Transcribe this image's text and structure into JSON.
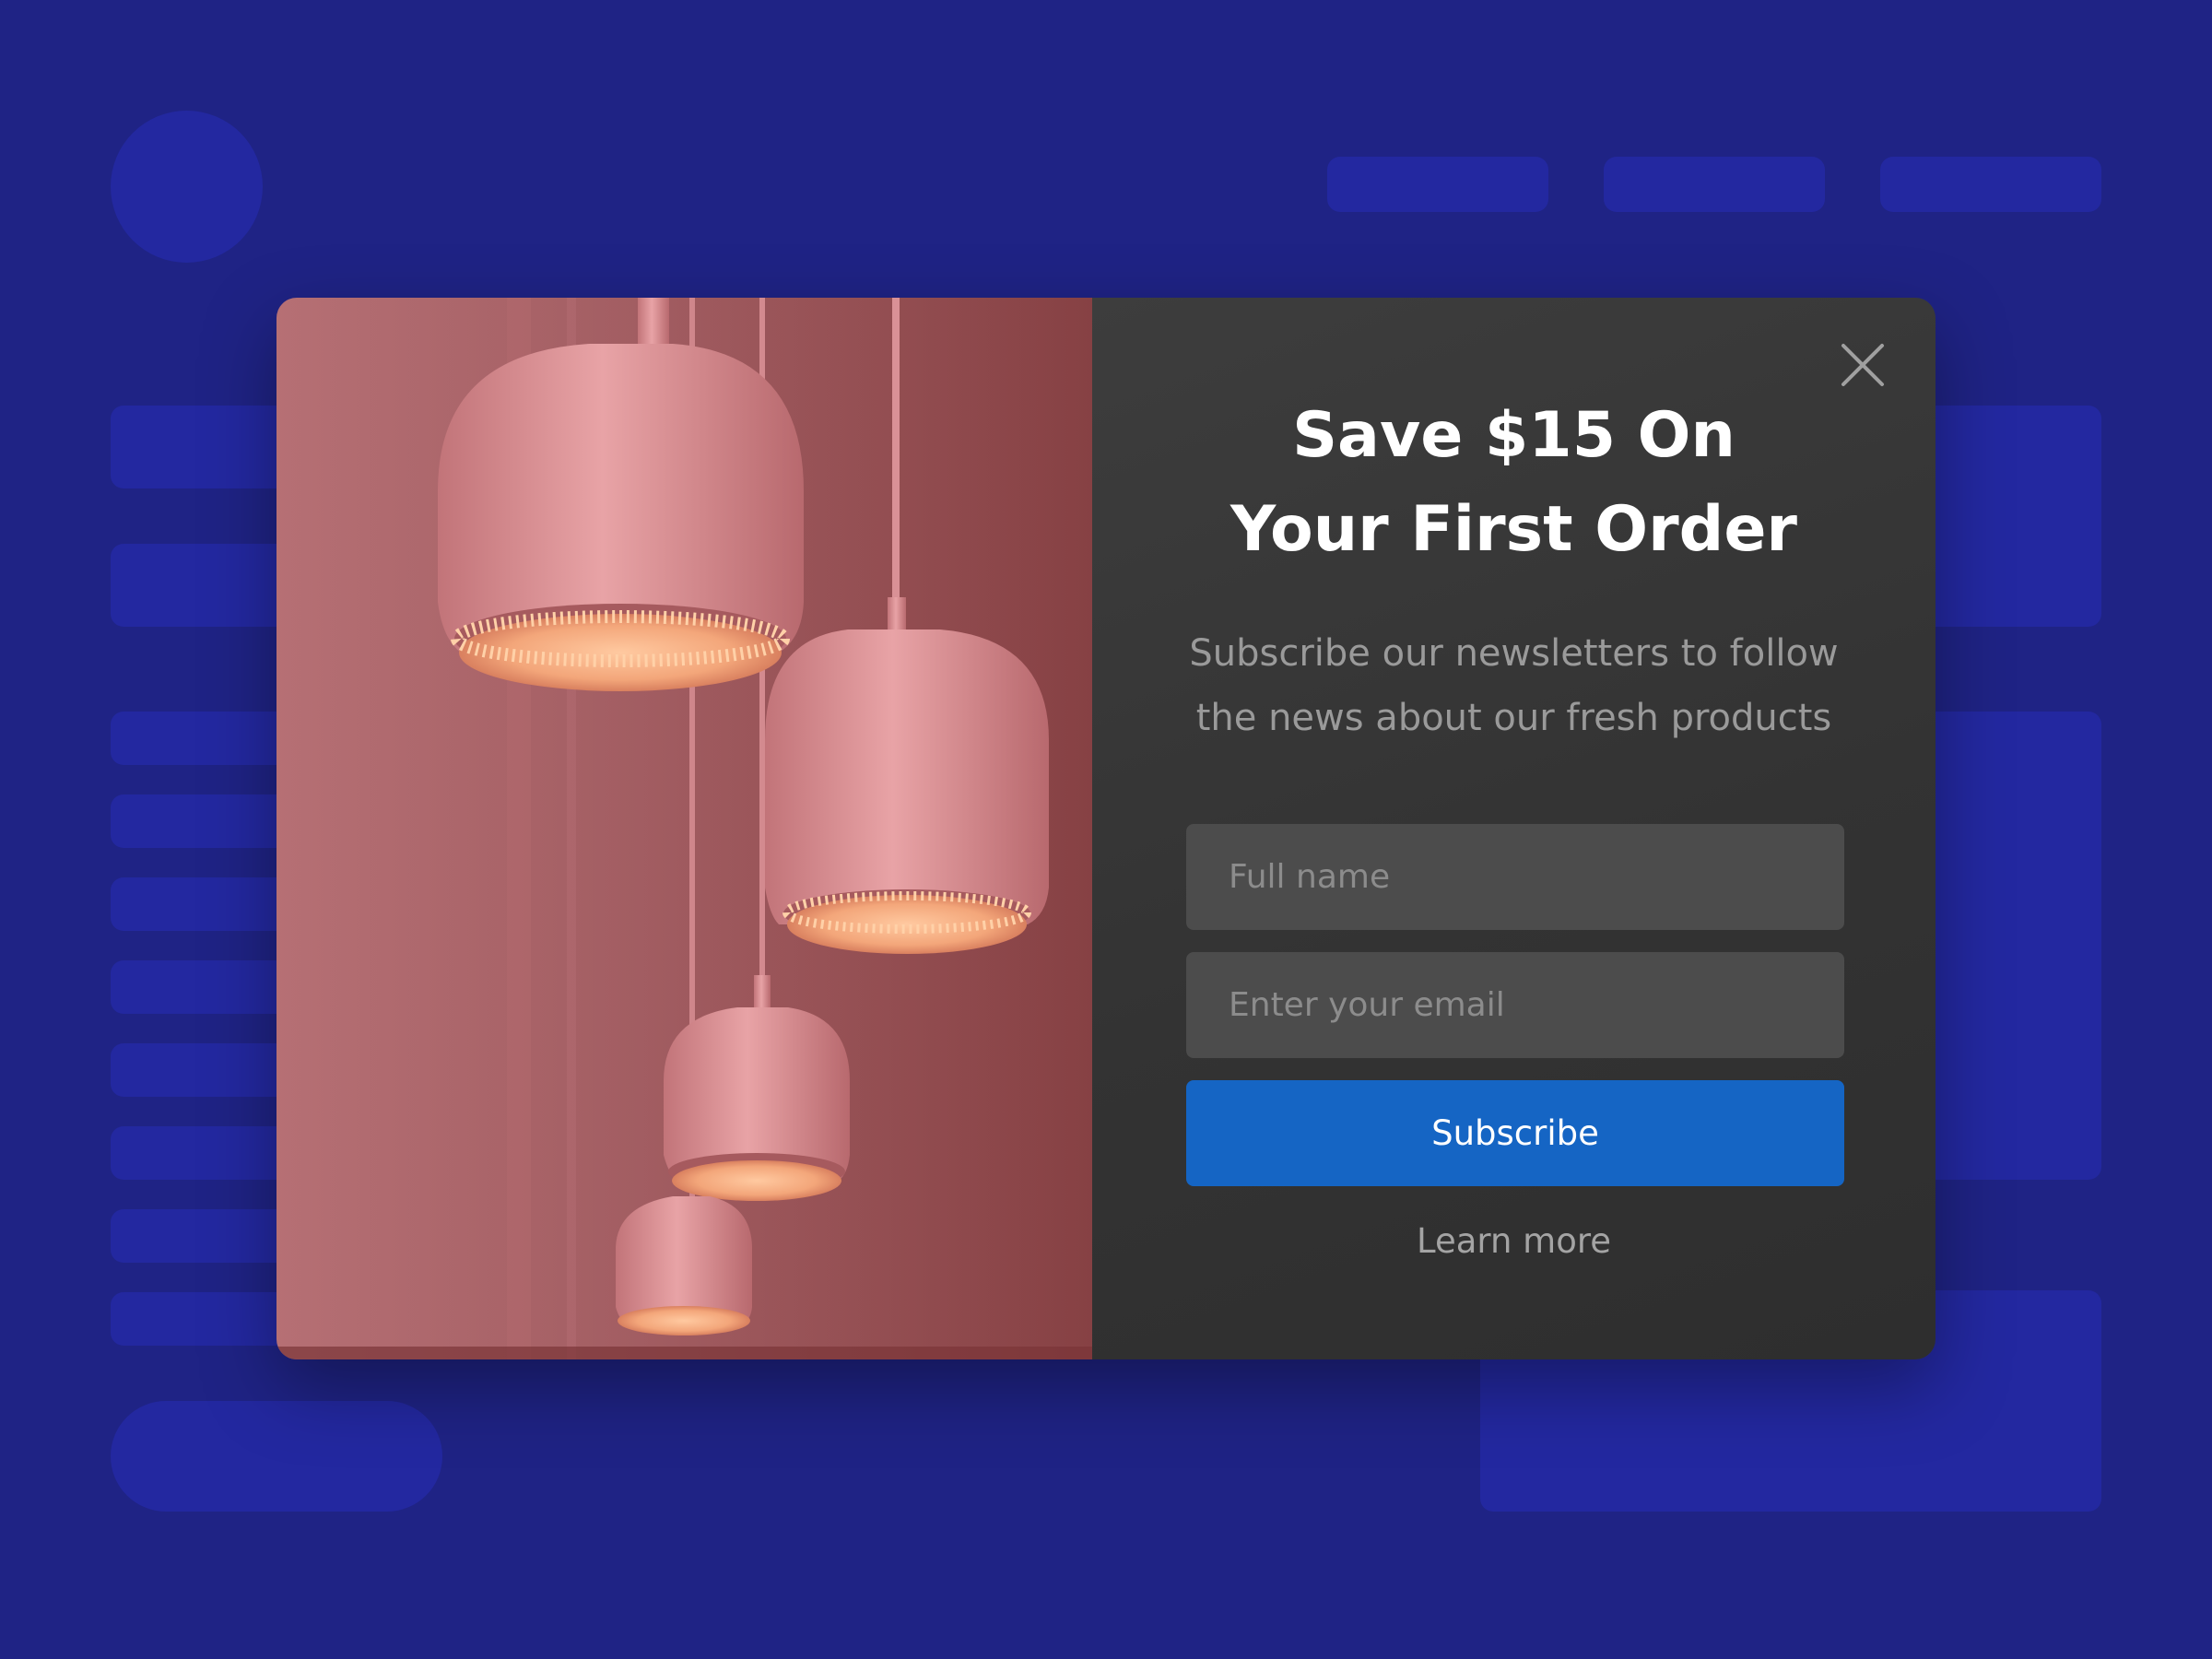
{
  "popup": {
    "headline_line1": "Save $15 On",
    "headline_line2": "Your First Order",
    "subtext_line1": "Subscribe our newsletters to follow",
    "subtext_line2": "the news about our fresh products",
    "name_placeholder": "Full name",
    "email_placeholder": "Enter your email",
    "subscribe_label": "Subscribe",
    "learn_more_label": "Learn more",
    "close_icon": "close-icon"
  },
  "colors": {
    "page_background": "#1f2385",
    "skeleton_blocks": "#2328a0",
    "content_panel": "#363636",
    "input_background": "#4c4c4c",
    "button_accent": "#1565c4",
    "image_tint": "#a35a5f"
  }
}
